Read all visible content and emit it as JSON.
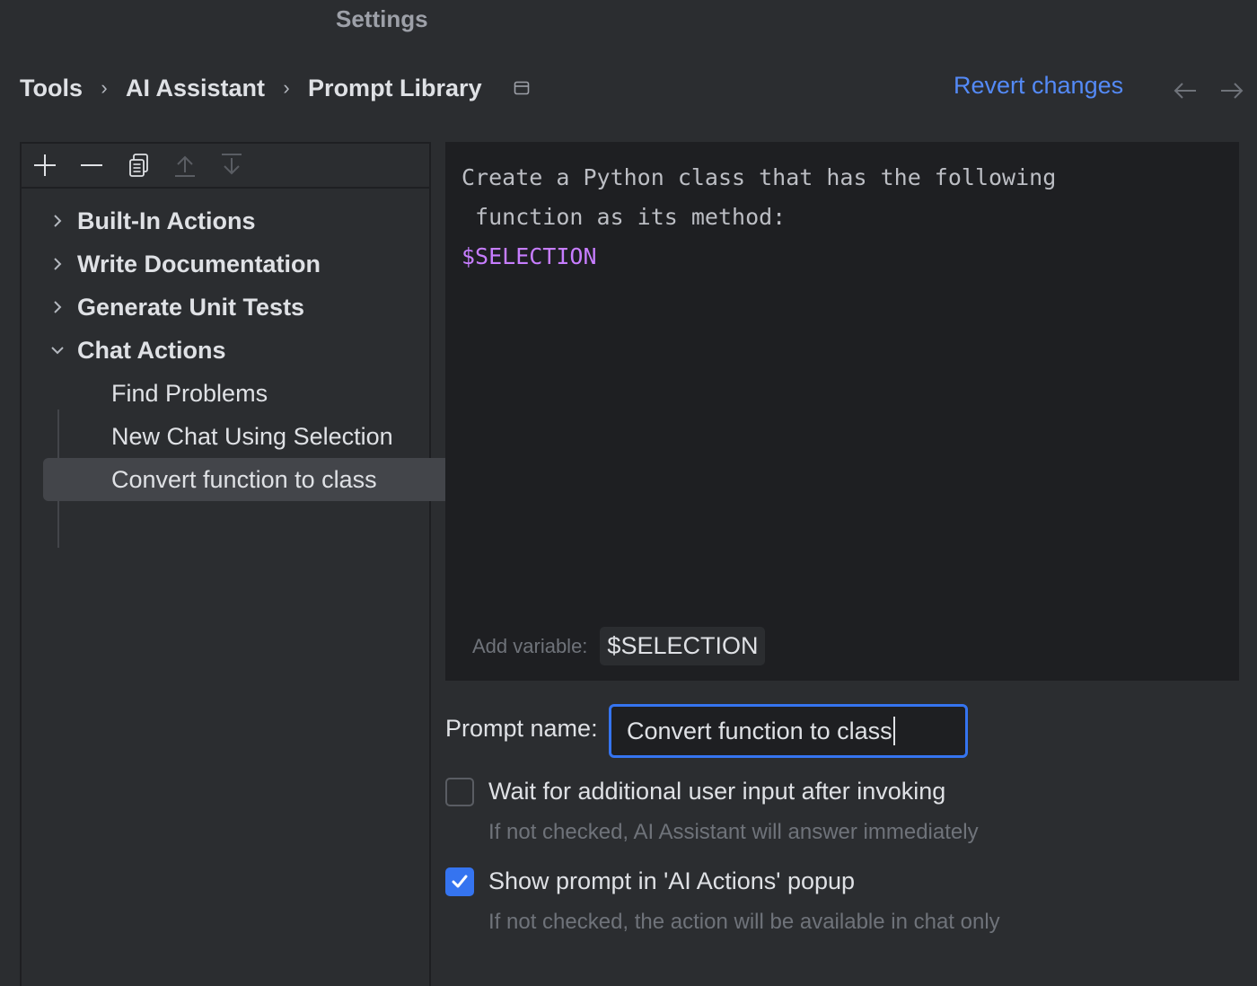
{
  "window": {
    "title": "Settings"
  },
  "breadcrumb": {
    "items": [
      "Tools",
      "AI Assistant",
      "Prompt Library"
    ],
    "separator": "›"
  },
  "header": {
    "revert_label": "Revert changes",
    "back_icon": "arrow-left-icon",
    "forward_icon": "arrow-right-icon"
  },
  "toolbar": {
    "icons": [
      "add-icon",
      "remove-icon",
      "copy-icon",
      "move-up-icon",
      "move-down-icon"
    ]
  },
  "tree": {
    "groups": [
      {
        "label": "Built-In Actions",
        "expanded": false
      },
      {
        "label": "Write Documentation",
        "expanded": false
      },
      {
        "label": "Generate Unit Tests",
        "expanded": false
      },
      {
        "label": "Chat Actions",
        "expanded": true
      }
    ],
    "chat_actions_items": [
      {
        "label": "Find Problems"
      },
      {
        "label": "New Chat Using Selection"
      },
      {
        "label": "Convert function to class",
        "selected": true
      }
    ]
  },
  "editor": {
    "line1": "Create a Python class that has the following",
    "line2": " function as its method:",
    "line3": "$SELECTION",
    "add_variable_label": "Add variable:",
    "variable_chip": "$SELECTION"
  },
  "form": {
    "prompt_name_label": "Prompt name:",
    "prompt_name_value": "Convert function to class",
    "wait_label": "Wait for additional user input after invoking",
    "wait_hint": "If not checked, AI Assistant will answer immediately",
    "wait_checked": false,
    "show_label": "Show prompt in 'AI Actions' popup",
    "show_hint": "If not checked, the action will be available in chat only",
    "show_checked": true
  },
  "colors": {
    "accent": "#3574f0",
    "link": "#548af7",
    "variable": "#c77dff",
    "background": "#2b2d30",
    "editor_background": "#1e1f22"
  }
}
